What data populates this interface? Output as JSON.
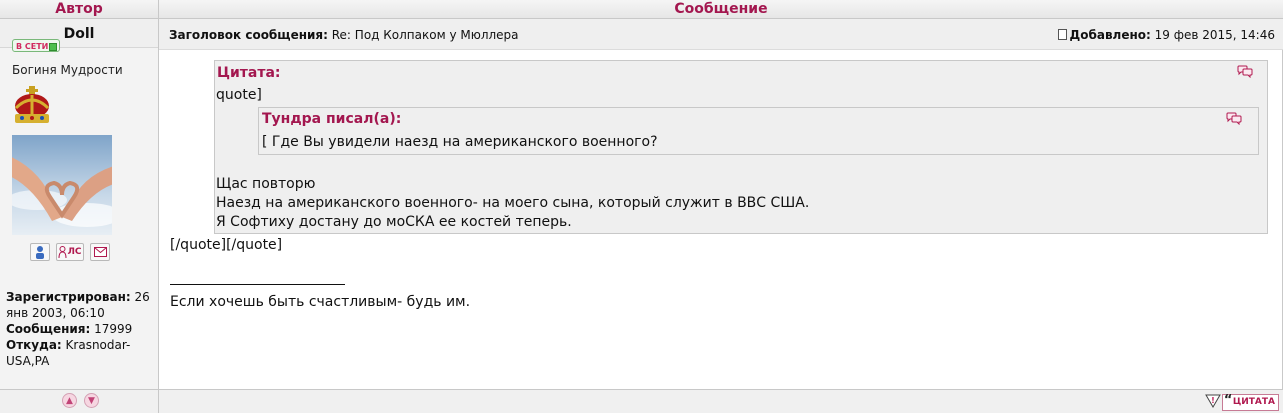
{
  "header": {
    "author_col": "Автор",
    "message_col": "Сообщение"
  },
  "author": {
    "name": "Doll",
    "online_badge": "В СЕТИ",
    "rank": "Богиня Мудрости",
    "profile_label_registered": "Зарегистрирован:",
    "registered": "26 янв 2003, 06:10",
    "profile_label_posts": "Сообщения:",
    "posts": "17999",
    "profile_label_from": "Откуда:",
    "from": "Krasnodar-USA,PA",
    "pm_label": "ЛС",
    "icons": [
      "profile-icon",
      "private-message-icon",
      "email-icon"
    ]
  },
  "post": {
    "subject_label": "Заголовок сообщения:",
    "subject": "Re: Под Колпаком у Мюллера",
    "added_label": "Добавлено:",
    "added": "19 фев 2015, 14:46",
    "quote_outer_title": "Цитата:",
    "quote_outer_first": "quote]",
    "quote_inner_title": "Тундра писал(а):",
    "quote_inner_text": "[ Где Вы увидели наезд на американского военного?",
    "quote_outer_lines": [
      "Щас повторю",
      "Наезд на американского военного- на моего сына, который служит в ВВС США.",
      "Я Софтиху достану до моСКА ее костей теперь."
    ],
    "after_quote": "[/quote][/quote]",
    "signature": "Если хочешь быть счастливым- будь им."
  },
  "footer": {
    "quote_button": "ЦИТАТА",
    "report_symbol": "!"
  },
  "colors": {
    "accent": "#a3174f",
    "header_bg": "#efefef",
    "quote_bg": "#efefef"
  }
}
